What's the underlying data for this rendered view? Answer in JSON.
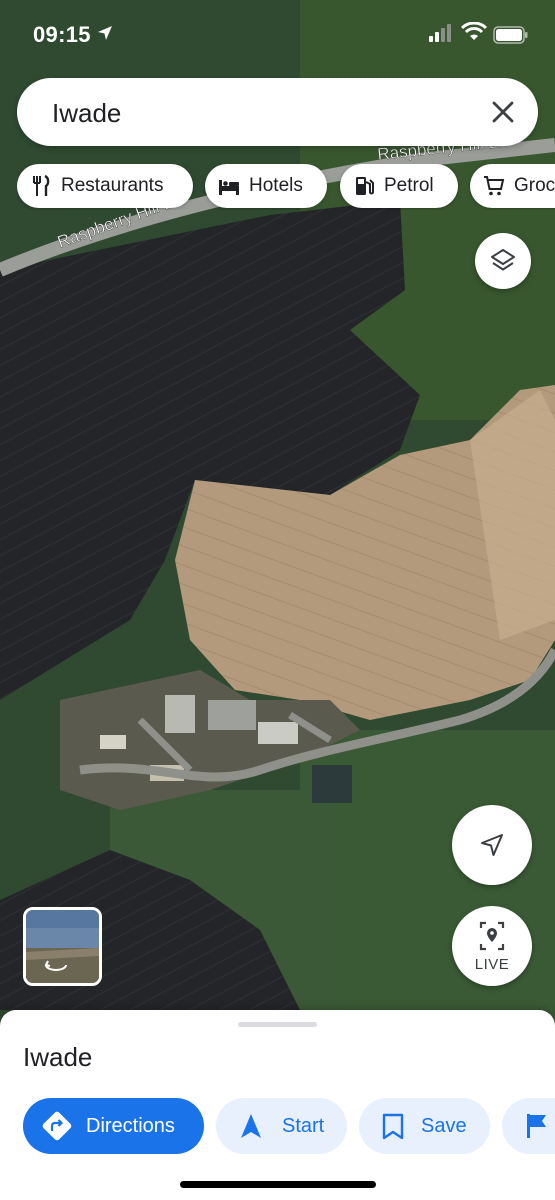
{
  "status_bar": {
    "time": "09:15",
    "icons": [
      "location-arrow-icon",
      "signal-icon",
      "wifi-icon",
      "battery-icon"
    ]
  },
  "search": {
    "query": "Iwade",
    "clear_icon": "close-icon"
  },
  "chips": [
    {
      "label": "Restaurants",
      "icon": "restaurant-icon"
    },
    {
      "label": "Hotels",
      "icon": "hotel-icon"
    },
    {
      "label": "Petrol",
      "icon": "petrol-icon"
    },
    {
      "label": "Groc",
      "icon": "grocery-cart-icon"
    }
  ],
  "map": {
    "road_labels": [
      "Raspberry Hill Ln",
      "Raspberry Hill Ln"
    ],
    "layers_icon": "layers-icon",
    "recenter_icon": "navigation-arrow-icon",
    "live_label": "LIVE"
  },
  "sheet": {
    "place_name": "Iwade",
    "actions": [
      {
        "label": "Directions",
        "icon": "directions-icon"
      },
      {
        "label": "Start",
        "icon": "navigation-icon"
      },
      {
        "label": "Save",
        "icon": "bookmark-icon"
      },
      {
        "label": "",
        "icon": "flag-icon"
      }
    ]
  },
  "colors": {
    "accent": "#1a73e8",
    "accent_light": "#e8f0fe",
    "text": "#202124"
  }
}
